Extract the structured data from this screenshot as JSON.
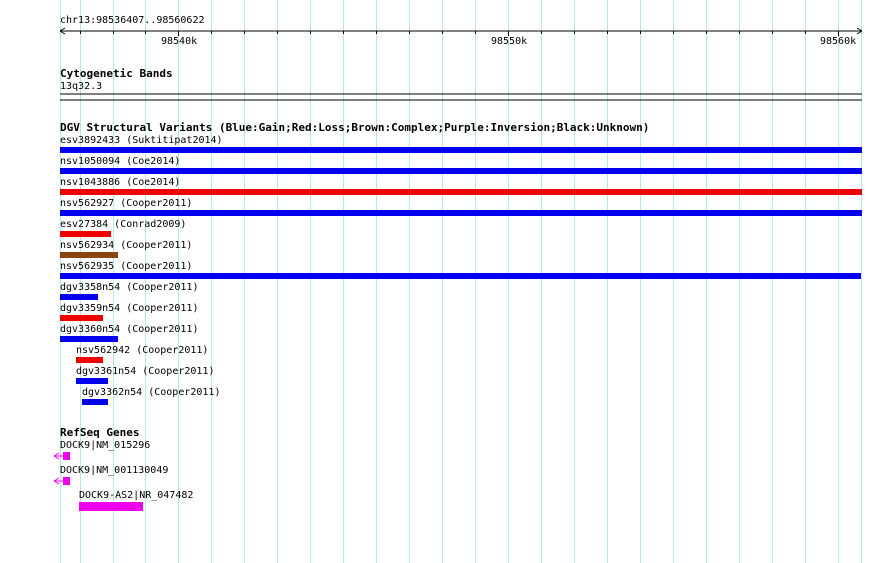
{
  "coordinate_label": "chr13:98536407..98560622",
  "ruler": {
    "ticks": [
      "98540k",
      "98550k",
      "98560k"
    ]
  },
  "tracks": {
    "cytogenetic": {
      "title": "Cytogenetic Bands",
      "band": "13q32.3"
    },
    "dgv": {
      "title": "DGV Structural Variants (Blue:Gain;Red:Loss;Brown:Complex;Purple:Inversion;Black:Unknown)",
      "features": [
        {
          "label": "esv3892433 (Suktitipat2014)",
          "color": "#0000ee"
        },
        {
          "label": "nsv1050094 (Coe2014)",
          "color": "#0000ee"
        },
        {
          "label": "nsv1043886 (Coe2014)",
          "color": "#ee0000"
        },
        {
          "label": "nsv562927 (Cooper2011)",
          "color": "#0000ee"
        },
        {
          "label": "esv27384 (Conrad2009)",
          "color": "#ee0000"
        },
        {
          "label": "nsv562934 (Cooper2011)",
          "color": "#8b4513"
        },
        {
          "label": "nsv562935 (Cooper2011)",
          "color": "#0000ee"
        },
        {
          "label": "dgv3358n54 (Cooper2011)",
          "color": "#0000ee"
        },
        {
          "label": "dgv3359n54 (Cooper2011)",
          "color": "#ee0000"
        },
        {
          "label": "dgv3360n54 (Cooper2011)",
          "color": "#0000ee"
        },
        {
          "label": "nsv562942 (Cooper2011)",
          "color": "#ee0000"
        },
        {
          "label": "dgv3361n54 (Cooper2011)",
          "color": "#0000ee"
        },
        {
          "label": "dgv3362n54 (Cooper2011)",
          "color": "#0000ee"
        }
      ]
    },
    "refseq": {
      "title": "RefSeq Genes",
      "features": [
        {
          "label": "DOCK9|NM_015296",
          "color": "#ee00ee"
        },
        {
          "label": "DOCK9|NM_001130049",
          "color": "#ee00ee"
        },
        {
          "label": "DOCK9-AS2|NR_047482",
          "color": "#ee00ee"
        }
      ]
    }
  }
}
